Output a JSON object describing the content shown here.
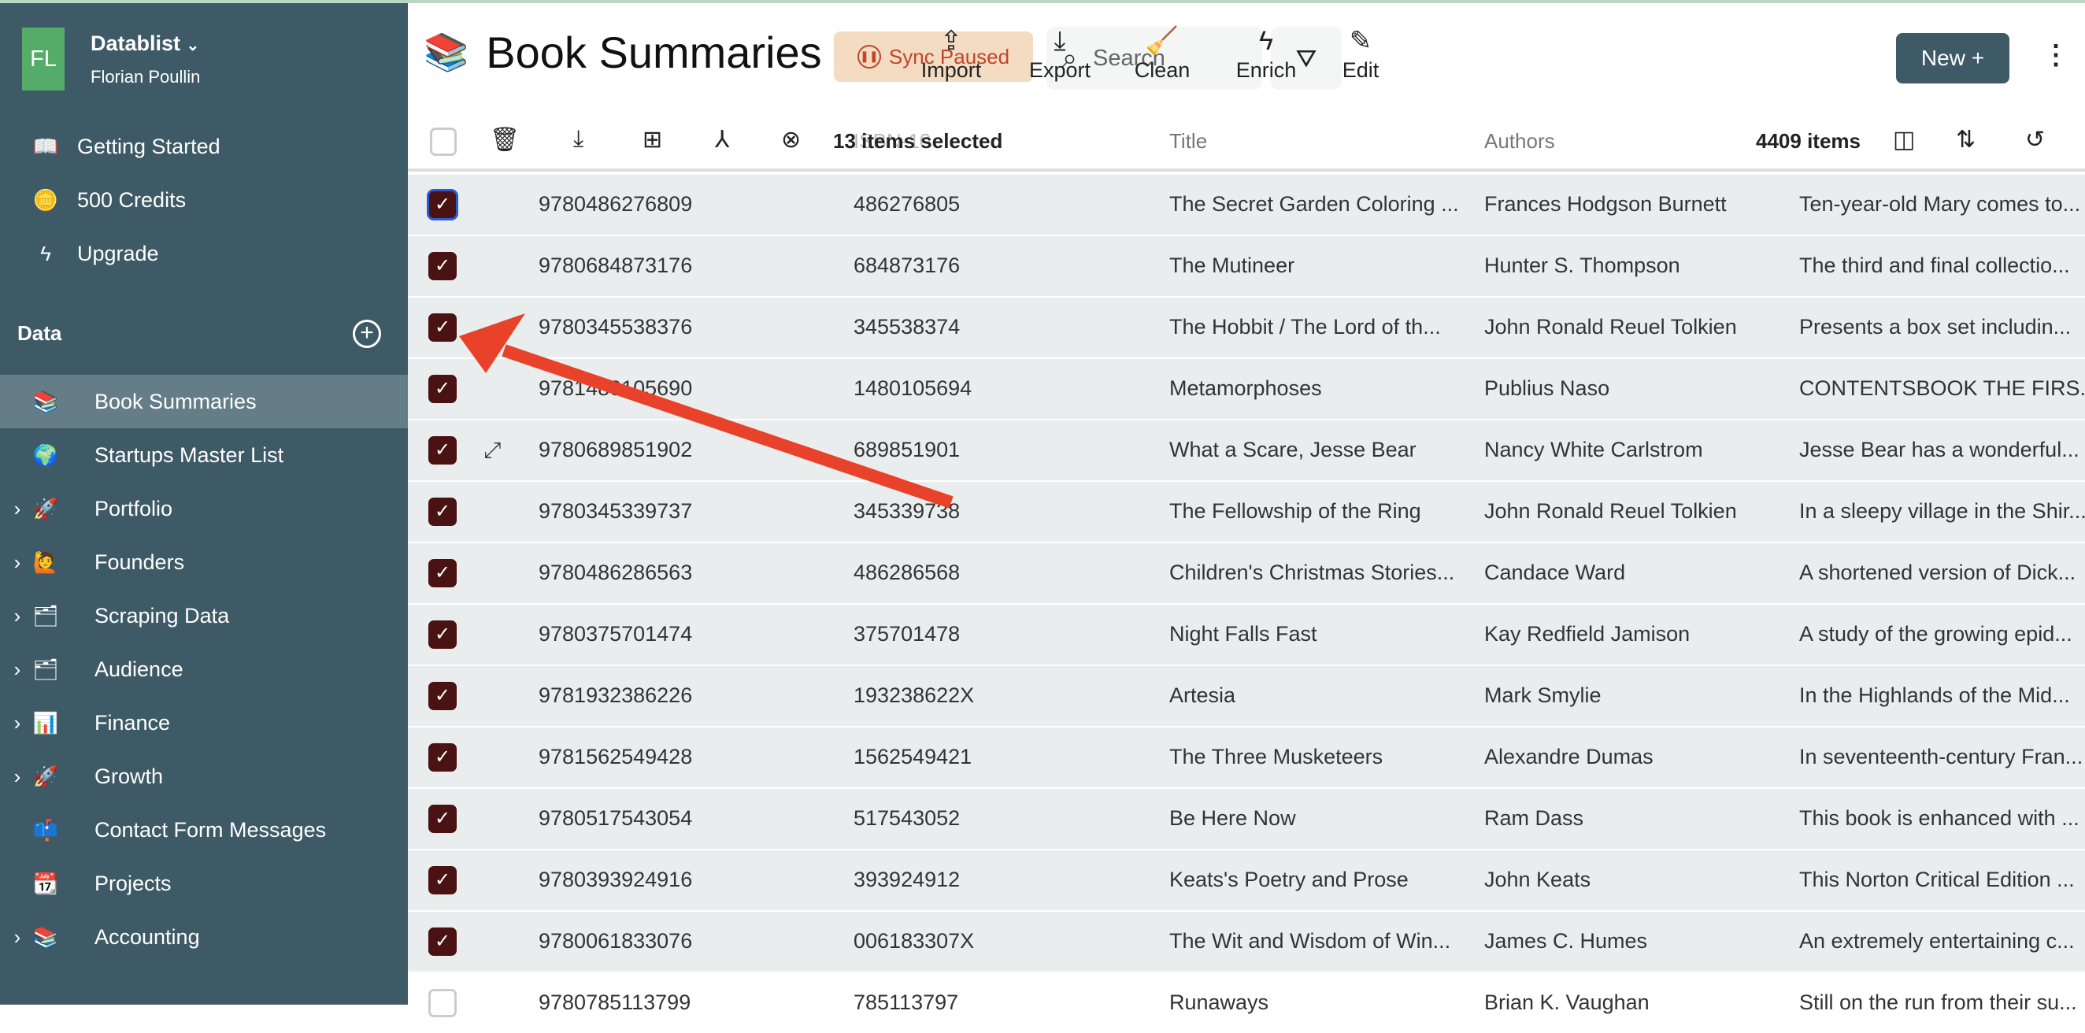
{
  "workspace": {
    "initials": "FL",
    "name": "Datablist",
    "user": "Florian Poullin"
  },
  "nav": [
    {
      "label": "Getting Started",
      "icon": "book-icon",
      "glyph": "📖"
    },
    {
      "label": "500 Credits",
      "icon": "coins-icon",
      "glyph": "🪙"
    },
    {
      "label": "Upgrade",
      "icon": "bolt-icon",
      "glyph": "ϟ"
    }
  ],
  "data_section": {
    "title": "Data"
  },
  "datasets": [
    {
      "label": "Book Summaries",
      "emoji": "📚",
      "expandable": false,
      "active": true
    },
    {
      "label": "Startups Master List",
      "emoji": "🌍",
      "expandable": false
    },
    {
      "label": "Portfolio",
      "emoji": "🚀",
      "expandable": true
    },
    {
      "label": "Founders",
      "emoji": "🙋",
      "expandable": true
    },
    {
      "label": "Scraping Data",
      "emoji": "🗂",
      "expandable": true
    },
    {
      "label": "Audience",
      "emoji": "🗂",
      "expandable": true
    },
    {
      "label": "Finance",
      "emoji": "📊",
      "expandable": true
    },
    {
      "label": "Growth",
      "emoji": "🚀",
      "expandable": true
    },
    {
      "label": "Contact Form Messages",
      "emoji": "📫",
      "expandable": false
    },
    {
      "label": "Projects",
      "emoji": "📆",
      "expandable": false
    },
    {
      "label": "Accounting",
      "emoji": "📚",
      "expandable": true
    }
  ],
  "header": {
    "emoji": "📚",
    "title": "Book Summaries",
    "sync": "Sync Paused",
    "search_placeholder": "Search",
    "new_label": "New +",
    "actions": [
      {
        "label": "Import",
        "glyph": "⇪"
      },
      {
        "label": "Export",
        "glyph": "⤓"
      },
      {
        "label": "Clean",
        "glyph": "🧹"
      },
      {
        "label": "Enrich",
        "glyph": "ϟ"
      },
      {
        "label": "Edit",
        "glyph": "✎"
      }
    ]
  },
  "table": {
    "selected_text": "13 items selected",
    "count_text": "4409 items",
    "headers": {
      "isbn10": "ISBN-10",
      "title": "Title",
      "authors": "Authors"
    },
    "accent": "#4a1212",
    "rows": [
      {
        "checked": true,
        "isbn13": "9780486276809",
        "isbn10": "486276805",
        "title": "The Secret Garden Coloring ...",
        "authors": "Frances Hodgson Burnett",
        "desc": "Ten-year-old Mary comes to..."
      },
      {
        "checked": true,
        "isbn13": "9780684873176",
        "isbn10": "684873176",
        "title": "The Mutineer",
        "authors": "Hunter S. Thompson",
        "desc": "The third and final collectio..."
      },
      {
        "checked": true,
        "isbn13": "9780345538376",
        "isbn10": "345538374",
        "title": "The Hobbit / The Lord of th...",
        "authors": "John Ronald Reuel Tolkien",
        "desc": "Presents a box set includin..."
      },
      {
        "checked": true,
        "isbn13": "9781480105690",
        "isbn10": "1480105694",
        "title": "Metamorphoses",
        "authors": "Publius Naso",
        "desc": "CONTENTSBOOK THE FIRS..."
      },
      {
        "checked": true,
        "isbn13": "9780689851902",
        "isbn10": "689851901",
        "title": "What a Scare, Jesse Bear",
        "authors": "Nancy White Carlstrom",
        "desc": "Jesse Bear has a wonderful..."
      },
      {
        "checked": true,
        "isbn13": "9780345339737",
        "isbn10": "345339738",
        "title": "The Fellowship of the Ring",
        "authors": "John Ronald Reuel Tolkien",
        "desc": "In a sleepy village in the Shir..."
      },
      {
        "checked": true,
        "isbn13": "9780486286563",
        "isbn10": "486286568",
        "title": "Children's Christmas Stories...",
        "authors": "Candace Ward",
        "desc": "A shortened version of Dick..."
      },
      {
        "checked": true,
        "isbn13": "9780375701474",
        "isbn10": "375701478",
        "title": "Night Falls Fast",
        "authors": "Kay Redfield Jamison",
        "desc": "A study of the growing epid..."
      },
      {
        "checked": true,
        "isbn13": "9781932386226",
        "isbn10": "193238622X",
        "title": "Artesia",
        "authors": "Mark Smylie",
        "desc": "In the Highlands of the Mid..."
      },
      {
        "checked": true,
        "isbn13": "9781562549428",
        "isbn10": "1562549421",
        "title": "The Three Musketeers",
        "authors": "Alexandre Dumas",
        "desc": "In seventeenth-century Fran..."
      },
      {
        "checked": true,
        "isbn13": "9780517543054",
        "isbn10": "517543052",
        "title": "Be Here Now",
        "authors": "Ram Dass",
        "desc": "This book is enhanced with ..."
      },
      {
        "checked": true,
        "isbn13": "9780393924916",
        "isbn10": "393924912",
        "title": "Keats's Poetry and Prose",
        "authors": "John Keats",
        "desc": "This Norton Critical Edition ..."
      },
      {
        "checked": true,
        "isbn13": "9780061833076",
        "isbn10": "006183307X",
        "title": "The Wit and Wisdom of Win...",
        "authors": "James C. Humes",
        "desc": "An extremely entertaining c..."
      },
      {
        "checked": false,
        "isbn13": "9780785113799",
        "isbn10": "785113797",
        "title": "Runaways",
        "authors": "Brian K. Vaughan",
        "desc": "Still on the run from their su..."
      }
    ]
  },
  "annotation": {
    "color": "#e8432a"
  }
}
